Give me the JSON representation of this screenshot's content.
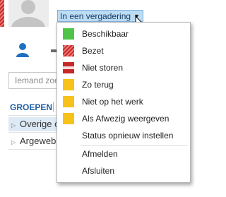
{
  "header": {
    "status_button": {
      "label": "In een vergadering",
      "arrow_icon": "dropdown-arrow-icon"
    },
    "presence_stripe_color": "#c62828"
  },
  "search": {
    "placeholder": "Iemand zoe"
  },
  "tabs": {
    "groups_label": "GROEPEN"
  },
  "groups": [
    {
      "label": "Overige c"
    },
    {
      "label": "Argeweb"
    }
  ],
  "status_menu": {
    "items": [
      {
        "label": "Beschikbaar",
        "color": "#4fc448",
        "access_key": "B"
      },
      {
        "label": "Bezet",
        "color": "#d32f2f",
        "access_key": "z"
      },
      {
        "label": "Niet storen",
        "color": "#c62828",
        "access_key": "N"
      },
      {
        "label": "Zo terug",
        "color": "#f7c21a",
        "access_key": "Z"
      },
      {
        "label": "Niet op het werk",
        "color": "#f7c21a",
        "access_key": "N"
      },
      {
        "label": "Als Afwezig weergeven",
        "color": "#f7c21a",
        "access_key": "l"
      }
    ],
    "reset_status": {
      "label": "Status opnieuw instellen",
      "access_key": "S"
    },
    "sign_out": {
      "label": "Afmelden",
      "access_key": "f"
    },
    "exit": {
      "label": "Afsluiten"
    }
  }
}
